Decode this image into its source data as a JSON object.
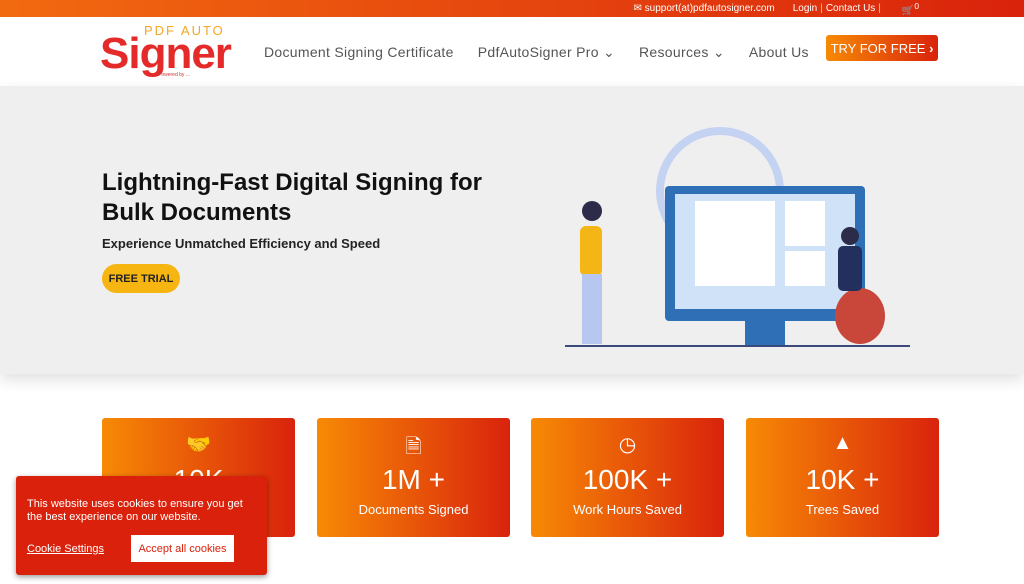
{
  "topbar": {
    "email": "support(at)pdfautosigner.com",
    "login": "Login",
    "contact": "Contact Us",
    "cart_count": "0"
  },
  "logo": {
    "top": "PDF AUTO",
    "main": "Signer",
    "powered": "Powered by ..."
  },
  "nav": {
    "items": [
      "Document Signing Certificate",
      "PdfAutoSigner Pro",
      "Resources",
      "About Us"
    ],
    "cta": "TRY FOR FREE"
  },
  "hero": {
    "title": "Lightning-Fast Digital Signing for Bulk Documents",
    "subtitle": "Experience Unmatched Efficiency and Speed",
    "button": "FREE TRIAL"
  },
  "stats": [
    {
      "icon": "handshake-icon",
      "value": "10K",
      "label": ""
    },
    {
      "icon": "document-icon",
      "value": "1M +",
      "label": "Documents Signed"
    },
    {
      "icon": "clock-icon",
      "value": "100K +",
      "label": "Work Hours Saved"
    },
    {
      "icon": "tree-icon",
      "value": "10K +",
      "label": "Trees Saved"
    }
  ],
  "cookie": {
    "message": "This website uses cookies to ensure you get the best experience on our website.",
    "settings": "Cookie Settings",
    "accept": "Accept all cookies"
  },
  "colors": {
    "accent_start": "#f78a05",
    "accent_end": "#d9230c",
    "cta_yellow": "#f7b511"
  }
}
